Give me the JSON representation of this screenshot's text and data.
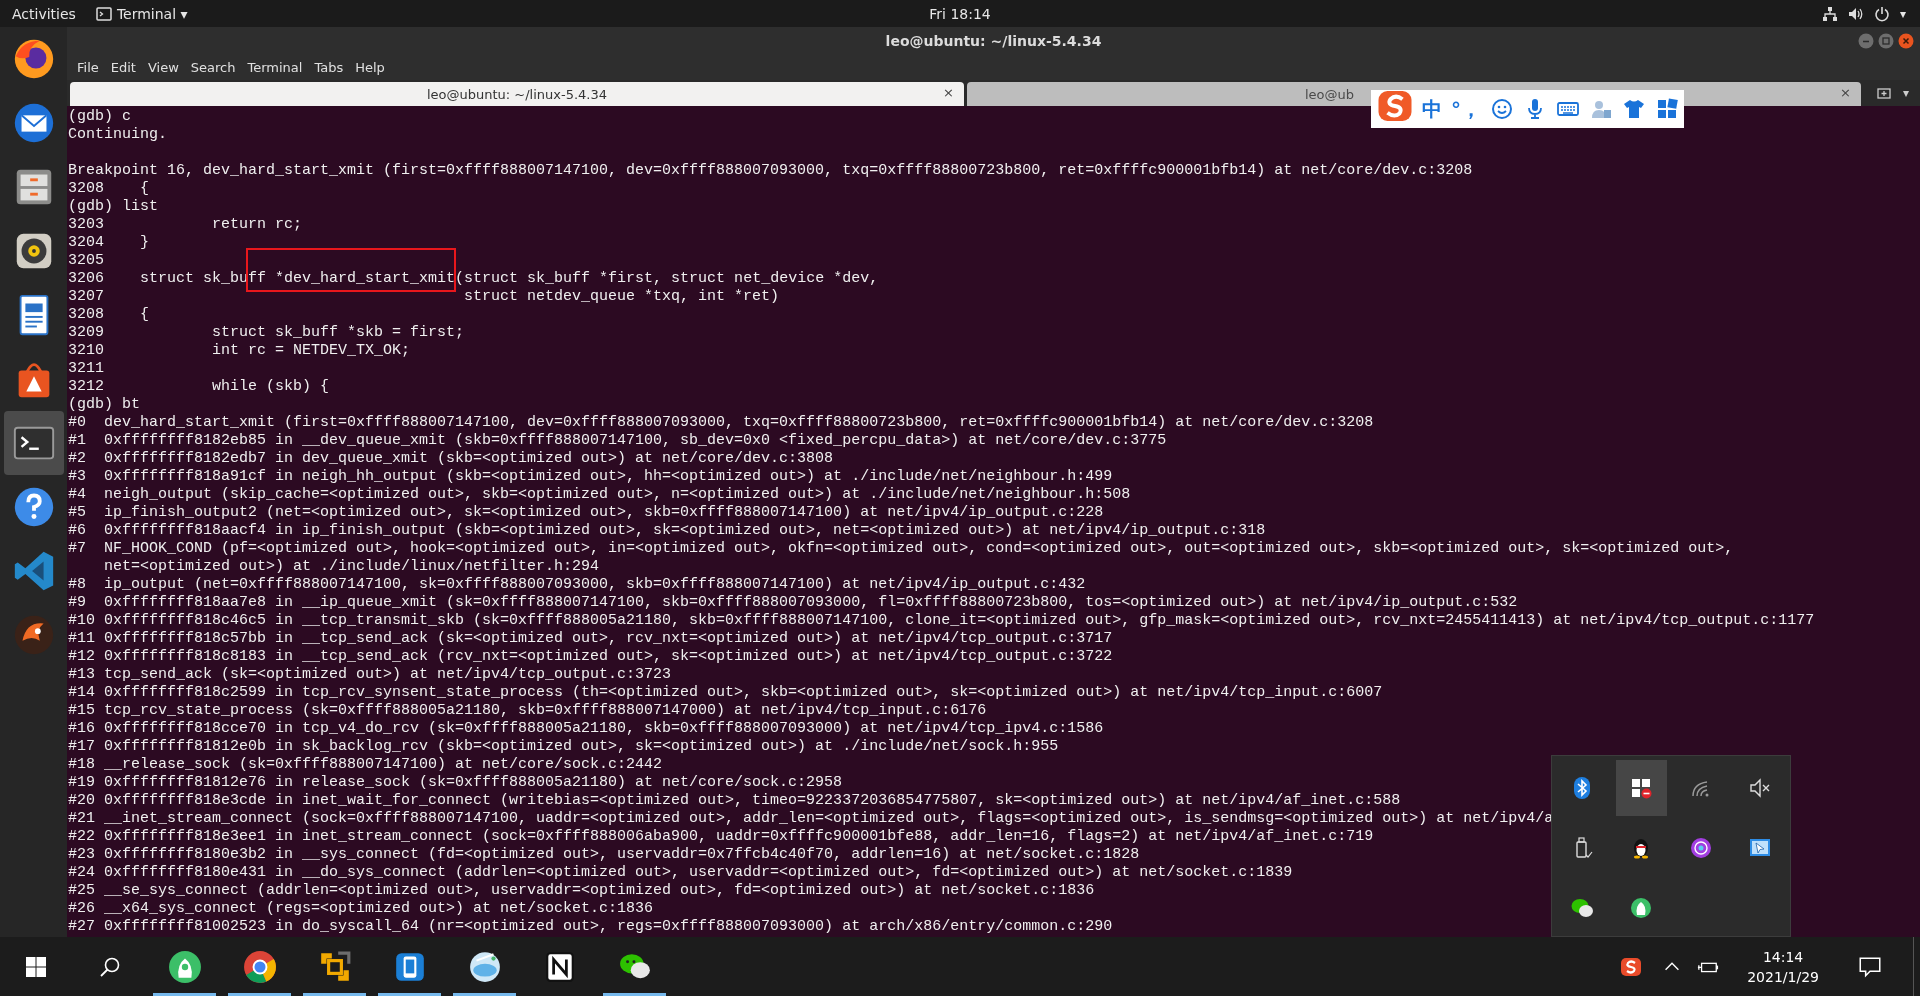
{
  "top_bar": {
    "activities": "Activities",
    "app_menu": "Terminal",
    "app_menu_caret": "▾",
    "clock": "Fri 18:14",
    "system_caret": "▾"
  },
  "dock": {
    "items": [
      {
        "kind": "firefox",
        "selected": false
      },
      {
        "kind": "thunderbird",
        "selected": false
      },
      {
        "kind": "files",
        "selected": false
      },
      {
        "kind": "rhythmbox",
        "selected": false
      },
      {
        "kind": "writer",
        "selected": false
      },
      {
        "kind": "software",
        "selected": false
      },
      {
        "kind": "terminal",
        "selected": true
      },
      {
        "kind": "help",
        "selected": false
      },
      {
        "kind": "vscode",
        "selected": false
      },
      {
        "kind": "app",
        "selected": false
      }
    ]
  },
  "window": {
    "title": "leo@ubuntu: ~/linux-5.4.34",
    "menu": [
      "File",
      "Edit",
      "View",
      "Search",
      "Terminal",
      "Tabs",
      "Help"
    ],
    "tabs": [
      {
        "label": "leo@ubuntu: ~/linux-5.4.34",
        "close": "×",
        "selected": true
      },
      {
        "label": "leo@ub",
        "close": "×",
        "selected": false
      }
    ],
    "new_tab_caret": "▾"
  },
  "terminal": {
    "lines": [
      {
        "kind": "text",
        "text": "(gdb) c"
      },
      {
        "kind": "text",
        "text": "Continuing."
      },
      {
        "kind": "blank"
      },
      {
        "kind": "text",
        "text": "Breakpoint 16, dev_hard_start_xmit (first=0xffff888007147100, dev=0xffff888007093000, txq=0xffff88800723b800, ret=0xffffc900001bfb14) at net/core/dev.c:3208"
      },
      {
        "kind": "text",
        "text": "3208    {"
      },
      {
        "kind": "text",
        "text": "(gdb) list"
      },
      {
        "kind": "text",
        "text": "3203            return rc;"
      },
      {
        "kind": "text",
        "text": "3204    }"
      },
      {
        "kind": "text",
        "text": "3205"
      },
      {
        "kind": "marked",
        "segments": [
          {
            "text": "3206    struct sk_bu",
            "boxed": false
          },
          {
            "text": "ff *dev_hard_start_xmit",
            "boxed": true
          },
          {
            "text": "(struct sk_buff *first, struct net_device *dev,",
            "boxed": false
          }
        ]
      },
      {
        "kind": "text",
        "text": "3207                                        struct netdev_queue *txq, int *ret)"
      },
      {
        "kind": "text",
        "text": "3208    {"
      },
      {
        "kind": "text",
        "text": "3209            struct sk_buff *skb = first;"
      },
      {
        "kind": "text",
        "text": "3210            int rc = NETDEV_TX_OK;"
      },
      {
        "kind": "text",
        "text": "3211"
      },
      {
        "kind": "text",
        "text": "3212            while (skb) {"
      },
      {
        "kind": "text",
        "text": "(gdb) bt"
      },
      {
        "kind": "text",
        "text": "#0  dev_hard_start_xmit (first=0xffff888007147100, dev=0xffff888007093000, txq=0xffff88800723b800, ret=0xffffc900001bfb14) at net/core/dev.c:3208"
      },
      {
        "kind": "text",
        "text": "#1  0xffffffff8182eb85 in __dev_queue_xmit (skb=0xffff888007147100, sb_dev=0x0 <fixed_percpu_data>) at net/core/dev.c:3775"
      },
      {
        "kind": "text",
        "text": "#2  0xffffffff8182edb7 in dev_queue_xmit (skb=<optimized out>) at net/core/dev.c:3808"
      },
      {
        "kind": "text",
        "text": "#3  0xffffffff818a91cf in neigh_hh_output (skb=<optimized out>, hh=<optimized out>) at ./include/net/neighbour.h:499"
      },
      {
        "kind": "text",
        "text": "#4  neigh_output (skip_cache=<optimized out>, skb=<optimized out>, n=<optimized out>) at ./include/net/neighbour.h:508"
      },
      {
        "kind": "text",
        "text": "#5  ip_finish_output2 (net=<optimized out>, sk=<optimized out>, skb=0xffff888007147100) at net/ipv4/ip_output.c:228"
      },
      {
        "kind": "text",
        "text": "#6  0xffffffff818aacf4 in ip_finish_output (skb=<optimized out>, sk=<optimized out>, net=<optimized out>) at net/ipv4/ip_output.c:318"
      },
      {
        "kind": "text",
        "text": "#7  NF_HOOK_COND (pf=<optimized out>, hook=<optimized out>, in=<optimized out>, okfn=<optimized out>, cond=<optimized out>, out=<optimized out>, skb=<optimized out>, sk=<optimized out>,"
      },
      {
        "kind": "text",
        "text": "    net=<optimized out>) at ./include/linux/netfilter.h:294"
      },
      {
        "kind": "text",
        "text": "#8  ip_output (net=0xffff888007147100, sk=0xffff888007093000, skb=0xffff888007147100) at net/ipv4/ip_output.c:432"
      },
      {
        "kind": "text",
        "text": "#9  0xffffffff818aa7e8 in __ip_queue_xmit (sk=0xffff888007147100, skb=0xffff888007093000, fl=0xffff88800723b800, tos=<optimized out>) at net/ipv4/ip_output.c:532"
      },
      {
        "kind": "text",
        "text": "#10 0xffffffff818c46c5 in __tcp_transmit_skb (sk=0xffff888005a21180, skb=0xffff888007147100, clone_it=<optimized out>, gfp_mask=<optimized out>, rcv_nxt=2455411413) at net/ipv4/tcp_output.c:1177"
      },
      {
        "kind": "text",
        "text": "#11 0xffffffff818c57bb in __tcp_send_ack (sk=<optimized out>, rcv_nxt=<optimized out>) at net/ipv4/tcp_output.c:3717"
      },
      {
        "kind": "text",
        "text": "#12 0xffffffff818c8183 in __tcp_send_ack (rcv_nxt=<optimized out>, sk=<optimized out>) at net/ipv4/tcp_output.c:3722"
      },
      {
        "kind": "text",
        "text": "#13 tcp_send_ack (sk=<optimized out>) at net/ipv4/tcp_output.c:3723"
      },
      {
        "kind": "text",
        "text": "#14 0xffffffff818c2599 in tcp_rcv_synsent_state_process (th=<optimized out>, skb=<optimized out>, sk=<optimized out>) at net/ipv4/tcp_input.c:6007"
      },
      {
        "kind": "text",
        "text": "#15 tcp_rcv_state_process (sk=0xffff888005a21180, skb=0xffff888007147000) at net/ipv4/tcp_input.c:6176"
      },
      {
        "kind": "text",
        "text": "#16 0xffffffff818cce70 in tcp_v4_do_rcv (sk=0xffff888005a21180, skb=0xffff888007093000) at net/ipv4/tcp_ipv4.c:1586"
      },
      {
        "kind": "text",
        "text": "#17 0xffffffff81812e0b in sk_backlog_rcv (skb=<optimized out>, sk=<optimized out>) at ./include/net/sock.h:955"
      },
      {
        "kind": "text",
        "text": "#18 __release_sock (sk=0xffff888007147100) at net/core/sock.c:2442"
      },
      {
        "kind": "text",
        "text": "#19 0xffffffff81812e76 in release_sock (sk=0xffff888005a21180) at net/core/sock.c:2958"
      },
      {
        "kind": "text",
        "text": "#20 0xffffffff818e3cde in inet_wait_for_connect (writebias=<optimized out>, timeo=9223372036854775807, sk=<optimized out>) at net/ipv4/af_inet.c:588"
      },
      {
        "kind": "text",
        "text": "#21 __inet_stream_connect (sock=0xffff888007147100, uaddr=<optimized out>, addr_len=<optimized out>, flags=<optimized out>, is_sendmsg=<optimized out>) at net/ipv4/a"
      },
      {
        "kind": "text",
        "text": "#22 0xffffffff818e3ee1 in inet_stream_connect (sock=0xffff888006aba900, uaddr=0xffffc900001bfe88, addr_len=16, flags=2) at net/ipv4/af_inet.c:719"
      },
      {
        "kind": "text",
        "text": "#23 0xffffffff8180e3b2 in __sys_connect (fd=<optimized out>, uservaddr=0x7ffcb4c40f70, addrlen=16) at net/socket.c:1828"
      },
      {
        "kind": "text",
        "text": "#24 0xffffffff8180e431 in __do_sys_connect (addrlen=<optimized out>, uservaddr=<optimized out>, fd=<optimized out>) at net/socket.c:1839"
      },
      {
        "kind": "text",
        "text": "#25 __se_sys_connect (addrlen=<optimized out>, uservaddr=<optimized out>, fd=<optimized out>) at net/socket.c:1836"
      },
      {
        "kind": "text",
        "text": "#26 __x64_sys_connect (regs=<optimized out>) at net/socket.c:1836"
      },
      {
        "kind": "text",
        "text": "#27 0xffffffff81002523 in do_syscall_64 (nr=<optimized out>, regs=0xffff888007093000) at arch/x86/entry/common.c:290"
      }
    ]
  },
  "ime_toolbar": {
    "items": [
      {
        "kind": "logo"
      },
      {
        "kind": "text",
        "text": "中"
      },
      {
        "kind": "text",
        "text": "°，"
      },
      {
        "kind": "smiley"
      },
      {
        "kind": "mic"
      },
      {
        "kind": "keyboard"
      },
      {
        "kind": "person"
      },
      {
        "kind": "shirt"
      },
      {
        "kind": "grid"
      }
    ]
  },
  "tray_popup": {
    "items": [
      {
        "kind": "bluetooth",
        "selected": false
      },
      {
        "kind": "windows",
        "selected": true
      },
      {
        "kind": "wireless",
        "selected": false
      },
      {
        "kind": "mute",
        "selected": false
      },
      {
        "kind": "usb",
        "selected": false
      },
      {
        "kind": "penguin",
        "selected": false
      },
      {
        "kind": "purple",
        "selected": false
      },
      {
        "kind": "screen",
        "selected": false
      },
      {
        "kind": "chat",
        "selected": false
      },
      {
        "kind": "green",
        "selected": false
      }
    ]
  },
  "taskbar": {
    "apps": [
      {
        "kind": "green",
        "running": true
      },
      {
        "kind": "chrome",
        "running": true
      },
      {
        "kind": "squares",
        "running": true
      },
      {
        "kind": "phone",
        "running": true
      },
      {
        "kind": "disk",
        "running": true
      },
      {
        "kind": "notion",
        "running": false
      },
      {
        "kind": "chat",
        "running": true
      }
    ],
    "time": "14:14",
    "date": "2021/1/29"
  }
}
